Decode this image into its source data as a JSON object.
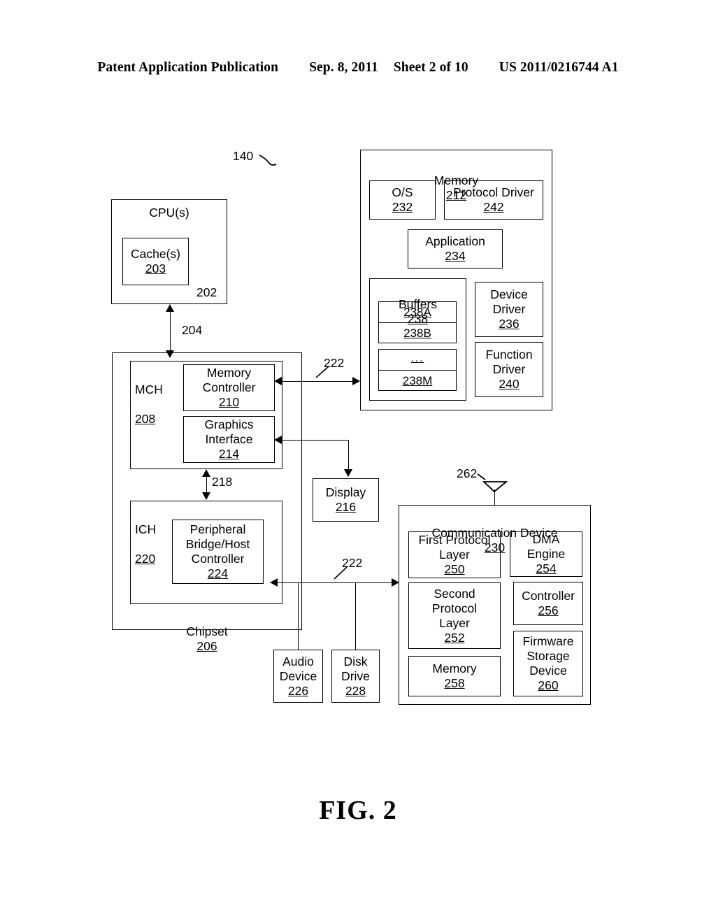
{
  "header": {
    "publication": "Patent Application Publication",
    "date": "Sep. 8, 2011",
    "sheet": "Sheet 2 of 10",
    "patent_number": "US 2011/0216744 A1"
  },
  "figure": {
    "caption": "FIG. 2",
    "system_ref": "140"
  },
  "cpu": {
    "title": "CPU(s)",
    "ref": "202",
    "cache": {
      "title": "Cache(s)",
      "ref": "203"
    },
    "bus_ref": "204"
  },
  "chipset": {
    "title": "Chipset",
    "ref": "206",
    "mch": {
      "title": "MCH",
      "ref": "208",
      "memory_controller": {
        "title": "Memory\nController",
        "ref": "210"
      },
      "graphics_interface": {
        "title": "Graphics\nInterface",
        "ref": "214"
      }
    },
    "interconnect_ref": "218",
    "ich": {
      "title": "ICH",
      "ref": "220",
      "peripheral_bridge": {
        "title": "Peripheral\nBridge/Host\nController",
        "ref": "224"
      }
    }
  },
  "memory": {
    "title": "Memory",
    "ref": "212",
    "os": {
      "title": "O/S",
      "ref": "232"
    },
    "protocol_driver": {
      "title": "Protocol Driver",
      "ref": "242"
    },
    "application": {
      "title": "Application",
      "ref": "234"
    },
    "buffers": {
      "title": "Buffers",
      "ref": "238",
      "group_one": [
        "238A",
        "238B"
      ],
      "group_two": [
        "...",
        "238M"
      ]
    },
    "device_driver": {
      "title": "Device\nDriver",
      "ref": "236"
    },
    "function_driver": {
      "title": "Function\nDriver",
      "ref": "240"
    }
  },
  "display": {
    "title": "Display",
    "ref": "216"
  },
  "audio_device": {
    "title": "Audio\nDevice",
    "ref": "226"
  },
  "disk_drive": {
    "title": "Disk\nDrive",
    "ref": "228"
  },
  "bus": {
    "upper_ref": "222",
    "lower_ref": "222"
  },
  "communication_device": {
    "title": "Communication Device",
    "ref": "230",
    "antenna_ref": "262",
    "first_protocol_layer": {
      "title": "First Protocol\nLayer",
      "ref": "250"
    },
    "second_protocol_layer": {
      "title": "Second\nProtocol\nLayer",
      "ref": "252"
    },
    "memory": {
      "title": "Memory",
      "ref": "258"
    },
    "dma_engine": {
      "title": "DMA\nEngine",
      "ref": "254"
    },
    "controller": {
      "title": "Controller",
      "ref": "256"
    },
    "firmware_storage": {
      "title": "Firmware\nStorage\nDevice",
      "ref": "260"
    }
  },
  "colors": {
    "ink": "#000000",
    "paper": "#ffffff"
  }
}
